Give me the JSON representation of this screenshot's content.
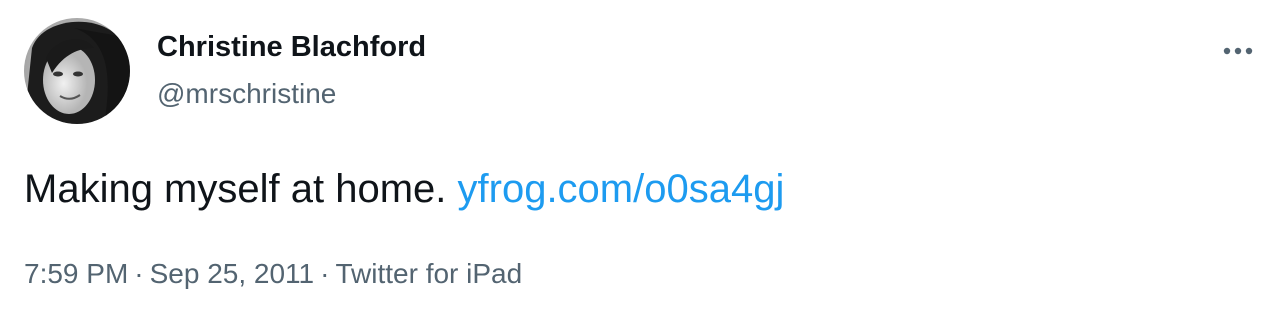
{
  "author": {
    "display_name": "Christine Blachford",
    "handle": "@mrschristine"
  },
  "tweet": {
    "text": "Making myself at home.",
    "link_text": "yfrog.com/o0sa4gj"
  },
  "meta": {
    "time": "7:59 PM",
    "date": "Sep 25, 2011",
    "source": "Twitter for iPad",
    "separator": "·"
  },
  "icons": {
    "more": "more-horizontal-icon"
  },
  "colors": {
    "text_primary": "#0f1419",
    "text_secondary": "#536471",
    "link": "#1d9bf0"
  }
}
